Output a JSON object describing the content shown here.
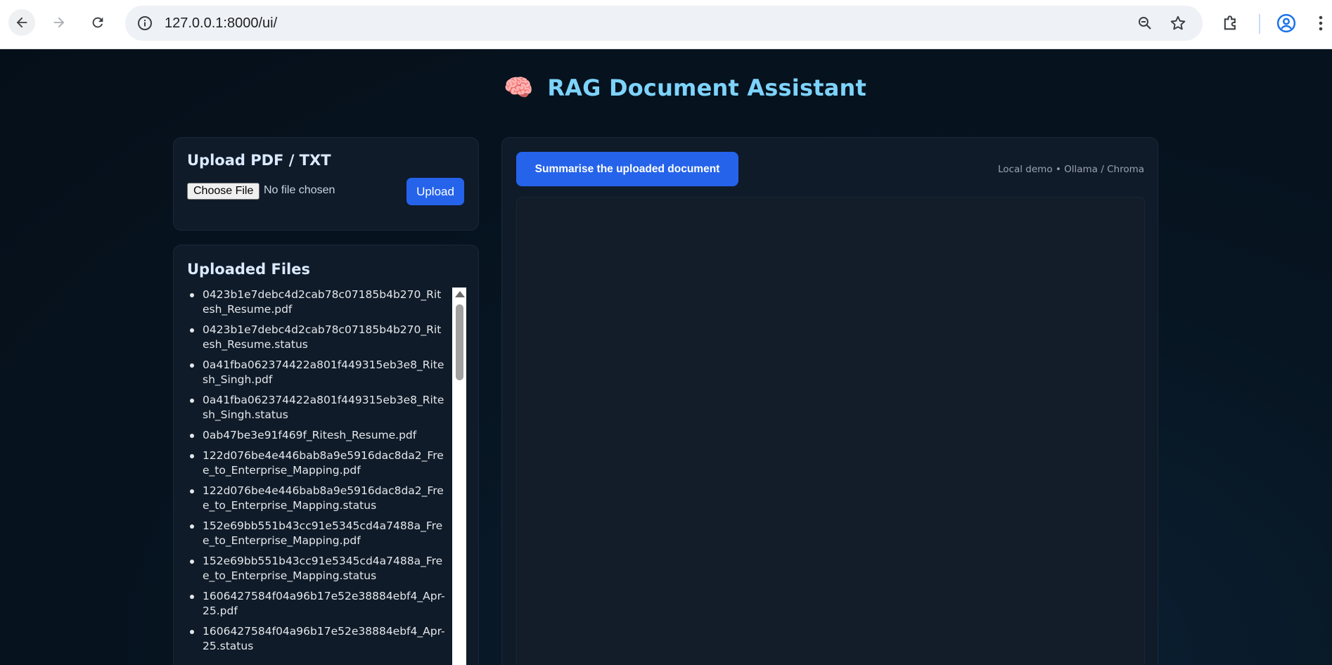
{
  "browser": {
    "url": "127.0.0.1:8000/ui/",
    "icons": [
      "back-arrow-icon",
      "forward-arrow-icon",
      "reload-icon",
      "site-info-icon",
      "zoom-icon",
      "bookmark-star-icon",
      "extensions-icon",
      "profile-icon",
      "more-menu-icon"
    ]
  },
  "header": {
    "emoji": "🧠",
    "title": "RAG Document Assistant"
  },
  "upload": {
    "heading": "Upload PDF / TXT",
    "choose_file_label": "Choose File",
    "file_status": "No file chosen",
    "upload_label": "Upload"
  },
  "files": {
    "heading": "Uploaded Files",
    "items": [
      "0423b1e7debc4d2cab78c07185b4b270_Ritesh_Resume.pdf",
      "0423b1e7debc4d2cab78c07185b4b270_Ritesh_Resume.status",
      "0a41fba062374422a801f449315eb3e8_Ritesh_Singh.pdf",
      "0a41fba062374422a801f449315eb3e8_Ritesh_Singh.status",
      "0ab47be3e91f469f_Ritesh_Resume.pdf",
      "122d076be4e446bab8a9e5916dac8da2_Free_to_Enterprise_Mapping.pdf",
      "122d076be4e446bab8a9e5916dac8da2_Free_to_Enterprise_Mapping.status",
      "152e69bb551b43cc91e5345cd4a7488a_Free_to_Enterprise_Mapping.pdf",
      "152e69bb551b43cc91e5345cd4a7488a_Free_to_Enterprise_Mapping.status",
      "1606427584f04a96b17e52e38884ebf4_Apr-25.pdf",
      "1606427584f04a96b17e52e38884ebf4_Apr-25.status"
    ]
  },
  "chat": {
    "summarise_label": "Summarise the uploaded document",
    "meta": "Local demo • Ollama / Chroma"
  },
  "colors": {
    "accent": "#2563eb",
    "title": "#7dd3fc",
    "background": "#06131f",
    "card": "#0f1b29"
  }
}
